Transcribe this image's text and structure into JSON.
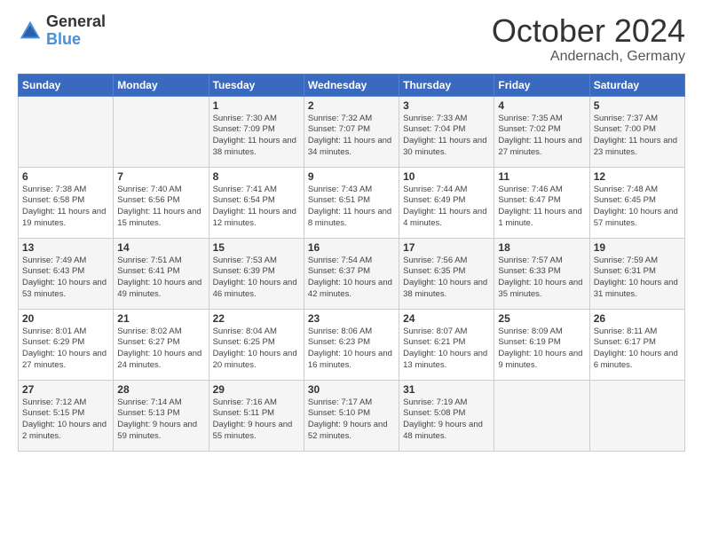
{
  "header": {
    "logo_general": "General",
    "logo_blue": "Blue",
    "title": "October 2024",
    "subtitle": "Andernach, Germany"
  },
  "days_of_week": [
    "Sunday",
    "Monday",
    "Tuesday",
    "Wednesday",
    "Thursday",
    "Friday",
    "Saturday"
  ],
  "weeks": [
    [
      {
        "day": "",
        "info": ""
      },
      {
        "day": "",
        "info": ""
      },
      {
        "day": "1",
        "info": "Sunrise: 7:30 AM\nSunset: 7:09 PM\nDaylight: 11 hours\nand 38 minutes."
      },
      {
        "day": "2",
        "info": "Sunrise: 7:32 AM\nSunset: 7:07 PM\nDaylight: 11 hours\nand 34 minutes."
      },
      {
        "day": "3",
        "info": "Sunrise: 7:33 AM\nSunset: 7:04 PM\nDaylight: 11 hours\nand 30 minutes."
      },
      {
        "day": "4",
        "info": "Sunrise: 7:35 AM\nSunset: 7:02 PM\nDaylight: 11 hours\nand 27 minutes."
      },
      {
        "day": "5",
        "info": "Sunrise: 7:37 AM\nSunset: 7:00 PM\nDaylight: 11 hours\nand 23 minutes."
      }
    ],
    [
      {
        "day": "6",
        "info": "Sunrise: 7:38 AM\nSunset: 6:58 PM\nDaylight: 11 hours\nand 19 minutes."
      },
      {
        "day": "7",
        "info": "Sunrise: 7:40 AM\nSunset: 6:56 PM\nDaylight: 11 hours\nand 15 minutes."
      },
      {
        "day": "8",
        "info": "Sunrise: 7:41 AM\nSunset: 6:54 PM\nDaylight: 11 hours\nand 12 minutes."
      },
      {
        "day": "9",
        "info": "Sunrise: 7:43 AM\nSunset: 6:51 PM\nDaylight: 11 hours\nand 8 minutes."
      },
      {
        "day": "10",
        "info": "Sunrise: 7:44 AM\nSunset: 6:49 PM\nDaylight: 11 hours\nand 4 minutes."
      },
      {
        "day": "11",
        "info": "Sunrise: 7:46 AM\nSunset: 6:47 PM\nDaylight: 11 hours\nand 1 minute."
      },
      {
        "day": "12",
        "info": "Sunrise: 7:48 AM\nSunset: 6:45 PM\nDaylight: 10 hours\nand 57 minutes."
      }
    ],
    [
      {
        "day": "13",
        "info": "Sunrise: 7:49 AM\nSunset: 6:43 PM\nDaylight: 10 hours\nand 53 minutes."
      },
      {
        "day": "14",
        "info": "Sunrise: 7:51 AM\nSunset: 6:41 PM\nDaylight: 10 hours\nand 49 minutes."
      },
      {
        "day": "15",
        "info": "Sunrise: 7:53 AM\nSunset: 6:39 PM\nDaylight: 10 hours\nand 46 minutes."
      },
      {
        "day": "16",
        "info": "Sunrise: 7:54 AM\nSunset: 6:37 PM\nDaylight: 10 hours\nand 42 minutes."
      },
      {
        "day": "17",
        "info": "Sunrise: 7:56 AM\nSunset: 6:35 PM\nDaylight: 10 hours\nand 38 minutes."
      },
      {
        "day": "18",
        "info": "Sunrise: 7:57 AM\nSunset: 6:33 PM\nDaylight: 10 hours\nand 35 minutes."
      },
      {
        "day": "19",
        "info": "Sunrise: 7:59 AM\nSunset: 6:31 PM\nDaylight: 10 hours\nand 31 minutes."
      }
    ],
    [
      {
        "day": "20",
        "info": "Sunrise: 8:01 AM\nSunset: 6:29 PM\nDaylight: 10 hours\nand 27 minutes."
      },
      {
        "day": "21",
        "info": "Sunrise: 8:02 AM\nSunset: 6:27 PM\nDaylight: 10 hours\nand 24 minutes."
      },
      {
        "day": "22",
        "info": "Sunrise: 8:04 AM\nSunset: 6:25 PM\nDaylight: 10 hours\nand 20 minutes."
      },
      {
        "day": "23",
        "info": "Sunrise: 8:06 AM\nSunset: 6:23 PM\nDaylight: 10 hours\nand 16 minutes."
      },
      {
        "day": "24",
        "info": "Sunrise: 8:07 AM\nSunset: 6:21 PM\nDaylight: 10 hours\nand 13 minutes."
      },
      {
        "day": "25",
        "info": "Sunrise: 8:09 AM\nSunset: 6:19 PM\nDaylight: 10 hours\nand 9 minutes."
      },
      {
        "day": "26",
        "info": "Sunrise: 8:11 AM\nSunset: 6:17 PM\nDaylight: 10 hours\nand 6 minutes."
      }
    ],
    [
      {
        "day": "27",
        "info": "Sunrise: 7:12 AM\nSunset: 5:15 PM\nDaylight: 10 hours\nand 2 minutes."
      },
      {
        "day": "28",
        "info": "Sunrise: 7:14 AM\nSunset: 5:13 PM\nDaylight: 9 hours\nand 59 minutes."
      },
      {
        "day": "29",
        "info": "Sunrise: 7:16 AM\nSunset: 5:11 PM\nDaylight: 9 hours\nand 55 minutes."
      },
      {
        "day": "30",
        "info": "Sunrise: 7:17 AM\nSunset: 5:10 PM\nDaylight: 9 hours\nand 52 minutes."
      },
      {
        "day": "31",
        "info": "Sunrise: 7:19 AM\nSunset: 5:08 PM\nDaylight: 9 hours\nand 48 minutes."
      },
      {
        "day": "",
        "info": ""
      },
      {
        "day": "",
        "info": ""
      }
    ]
  ]
}
